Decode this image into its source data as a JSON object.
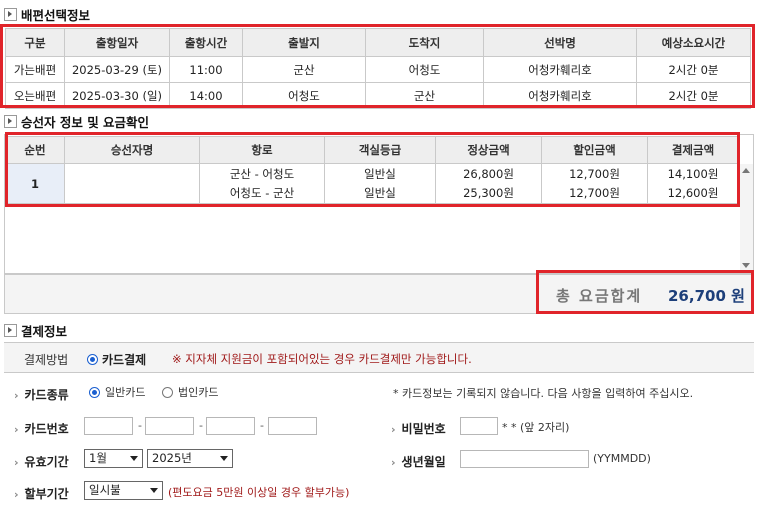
{
  "sections": {
    "schedule_title": "배편선택정보",
    "passenger_title": "승선자 정보 및 요금확인",
    "payment_title": "결제정보"
  },
  "schedule": {
    "headers": [
      "구분",
      "출항일자",
      "출항시간",
      "출발지",
      "도착지",
      "선박명",
      "예상소요시간"
    ],
    "rows": [
      [
        "가는배편",
        "2025-03-29 (토)",
        "11:00",
        "군산",
        "어청도",
        "어청카훼리호",
        "2시간 0분"
      ],
      [
        "오는배편",
        "2025-03-30 (일)",
        "14:00",
        "어청도",
        "군산",
        "어청카훼리호",
        "2시간 0분"
      ]
    ]
  },
  "passengers": {
    "headers": [
      "순번",
      "승선자명",
      "항로",
      "객실등급",
      "정상금액",
      "할인금액",
      "결제금액"
    ],
    "row": {
      "no": "1",
      "name": "",
      "routes": [
        "군산 - 어청도",
        "어청도 - 군산"
      ],
      "grades": [
        "일반실",
        "일반실"
      ],
      "normal": [
        "26,800원",
        "25,300원"
      ],
      "discount": [
        "12,700원",
        "12,700원"
      ],
      "pay": [
        "14,100원",
        "12,600원"
      ]
    }
  },
  "total": {
    "label": "총 요금합계",
    "value": "26,700 원"
  },
  "payment": {
    "method_label": "결제방법",
    "method_option": "카드결제",
    "notice": "※ 지자체 지원금이 포함되어있는 경우 카드결제만 가능합니다.",
    "card_type_label": "카드종류",
    "card_type_options": [
      "일반카드",
      "법인카드"
    ],
    "card_info_note": "* 카드정보는 기록되지 않습니다. 다음 사항을 입력하여 주십시오.",
    "card_number_label": "카드번호",
    "password_label": "비밀번호",
    "password_hint": "* * (앞 2자리)",
    "expiry_label": "유효기간",
    "expiry_month": "1월",
    "expiry_year": "2025년",
    "birth_label": "생년월일",
    "birth_hint": "(YYMMDD)",
    "installment_label": "할부기간",
    "installment_value": "일시불",
    "installment_note": "(편도요금 5만원 이상일 경우 할부가능)"
  },
  "colors": {
    "highlight_red": "#e0242a",
    "total_blue": "#1d3f7a",
    "notice_maroon": "#a01a1a",
    "radio_blue": "#1a5fd0"
  }
}
